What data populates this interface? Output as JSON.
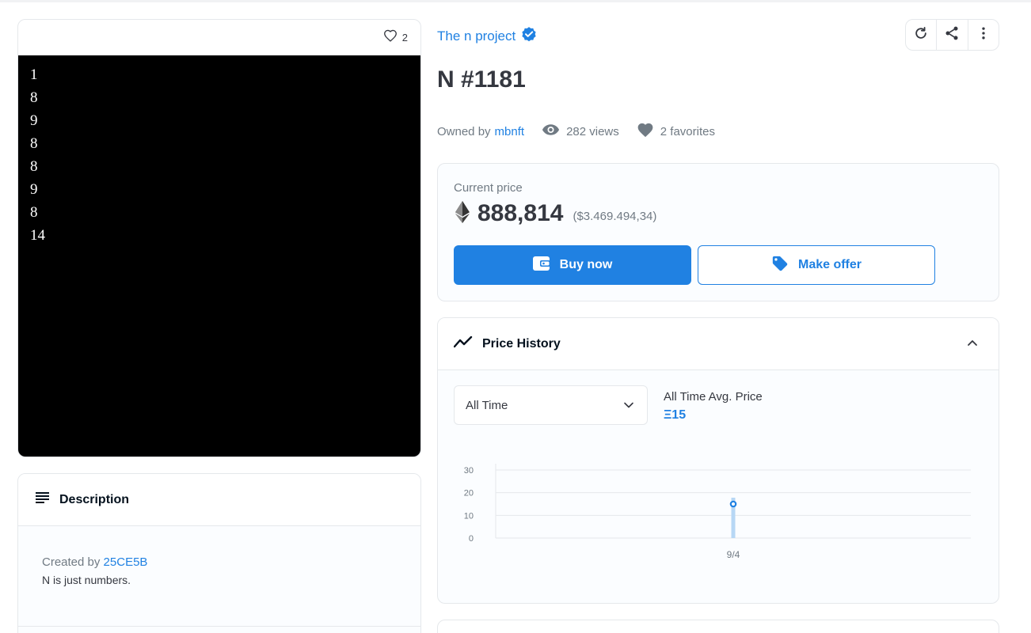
{
  "media": {
    "favorite_count": "2",
    "numbers": [
      "1",
      "8",
      "9",
      "8",
      "8",
      "9",
      "8",
      "14"
    ]
  },
  "description": {
    "title": "Description",
    "created_by_label": "Created by",
    "creator": "25CE5B",
    "text": "N is just numbers."
  },
  "collection": {
    "name": "The n project",
    "verified_icon": "verified-badge-icon"
  },
  "toolbar": {
    "icons": [
      "refresh-icon",
      "share-icon",
      "more-vertical-icon"
    ]
  },
  "item": {
    "title": "N #1181",
    "owned_by_label": "Owned by",
    "owner": "mbnft",
    "views": "282 views",
    "favorites": "2 favorites"
  },
  "price": {
    "label": "Current price",
    "value": "888,814",
    "usd": "($3.469.494,34)",
    "buy_label": "Buy now",
    "offer_label": "Make offer"
  },
  "history": {
    "title": "Price History",
    "period": "All Time",
    "avg_label": "All Time Avg. Price",
    "avg_value": "Ξ15"
  },
  "colors": {
    "accent": "#2081e2",
    "text": "#353840",
    "muted": "#707a83",
    "border": "#e5e8eb",
    "bar": "#b7d7f5"
  },
  "chart_data": {
    "type": "scatter",
    "x": [
      "9/4"
    ],
    "y": [
      15
    ],
    "ylim": [
      0,
      30
    ],
    "yticks": [
      0,
      10,
      20,
      30
    ],
    "grid": true
  }
}
